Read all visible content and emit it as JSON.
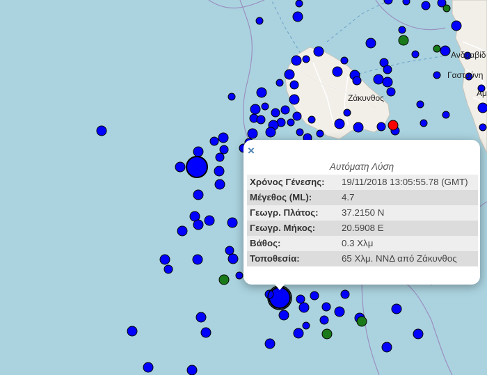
{
  "map": {
    "place_labels": {
      "zakynthos": "Ζάκυνθος",
      "andravida": "Ανδραβίδ",
      "gastouni": "Γαστούνη",
      "amaliada": "Αμ"
    },
    "marker_colors": {
      "automatic": "#0000ff",
      "reviewed": "#1a7a1a",
      "latest": "#ff0000"
    },
    "water_color": "#aad3df",
    "land_color": "#f2efe9"
  },
  "popup": {
    "close_label": "×",
    "title": "Αυτόματη Λύση",
    "rows": [
      {
        "label": "Χρόνος Γένεσης:",
        "value": "19/11/2018 13:05:55.78 (GMT)"
      },
      {
        "label": "Μέγεθος (ML):",
        "value": "4.7"
      },
      {
        "label": "Γεωγρ. Πλάτος:",
        "value": "37.2150 N"
      },
      {
        "label": "Γεωγρ. Μήκος:",
        "value": "20.5908 E"
      },
      {
        "label": "Βάθος:",
        "value": "0.3 Χλμ"
      },
      {
        "label": "Τοποθεσία:",
        "value": "65 Χλμ. ΝΝΔ από Ζάκυνθος"
      }
    ]
  }
}
